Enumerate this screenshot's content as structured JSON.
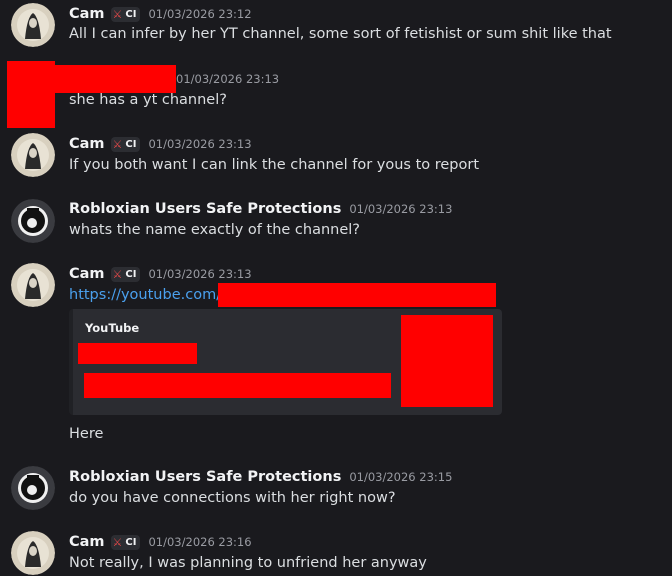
{
  "messages": [
    {
      "author": "Cam",
      "tag": "CI",
      "tag_icon": "sword-icon",
      "timestamp": "01/03/2026 23:12",
      "text": "All I can infer by her YT channel, some sort of fetishist or sum shit like that"
    },
    {
      "timestamp": "01/03/2026 23:13",
      "text": "she has a yt channel?"
    },
    {
      "author": "Cam",
      "tag": "CI",
      "tag_icon": "sword-icon",
      "timestamp": "01/03/2026 23:13",
      "text": "If you both want I can link the channel for yous to report"
    },
    {
      "author": "Robloxian Users Safe Protections",
      "timestamp": "01/03/2026 23:13",
      "text": "whats the name exactly of the channel?"
    },
    {
      "author": "Cam",
      "tag": "CI",
      "tag_icon": "sword-icon",
      "timestamp": "01/03/2026 23:13",
      "link": "https://youtube.com/(",
      "embed_provider": "YouTube",
      "text": "Here"
    },
    {
      "author": "Robloxian Users Safe Protections",
      "timestamp": "01/03/2026 23:15",
      "text": "do you have connections with her right now?"
    },
    {
      "author": "Cam",
      "tag": "CI",
      "tag_icon": "sword-icon",
      "timestamp": "01/03/2026 23:16",
      "text": "Not really, I was planning to unfriend her anyway"
    }
  ],
  "colors": {
    "background": "#1a1a1e",
    "link": "#4aa0ee",
    "redaction": "#ff0000",
    "embed": "#2b2c31"
  }
}
